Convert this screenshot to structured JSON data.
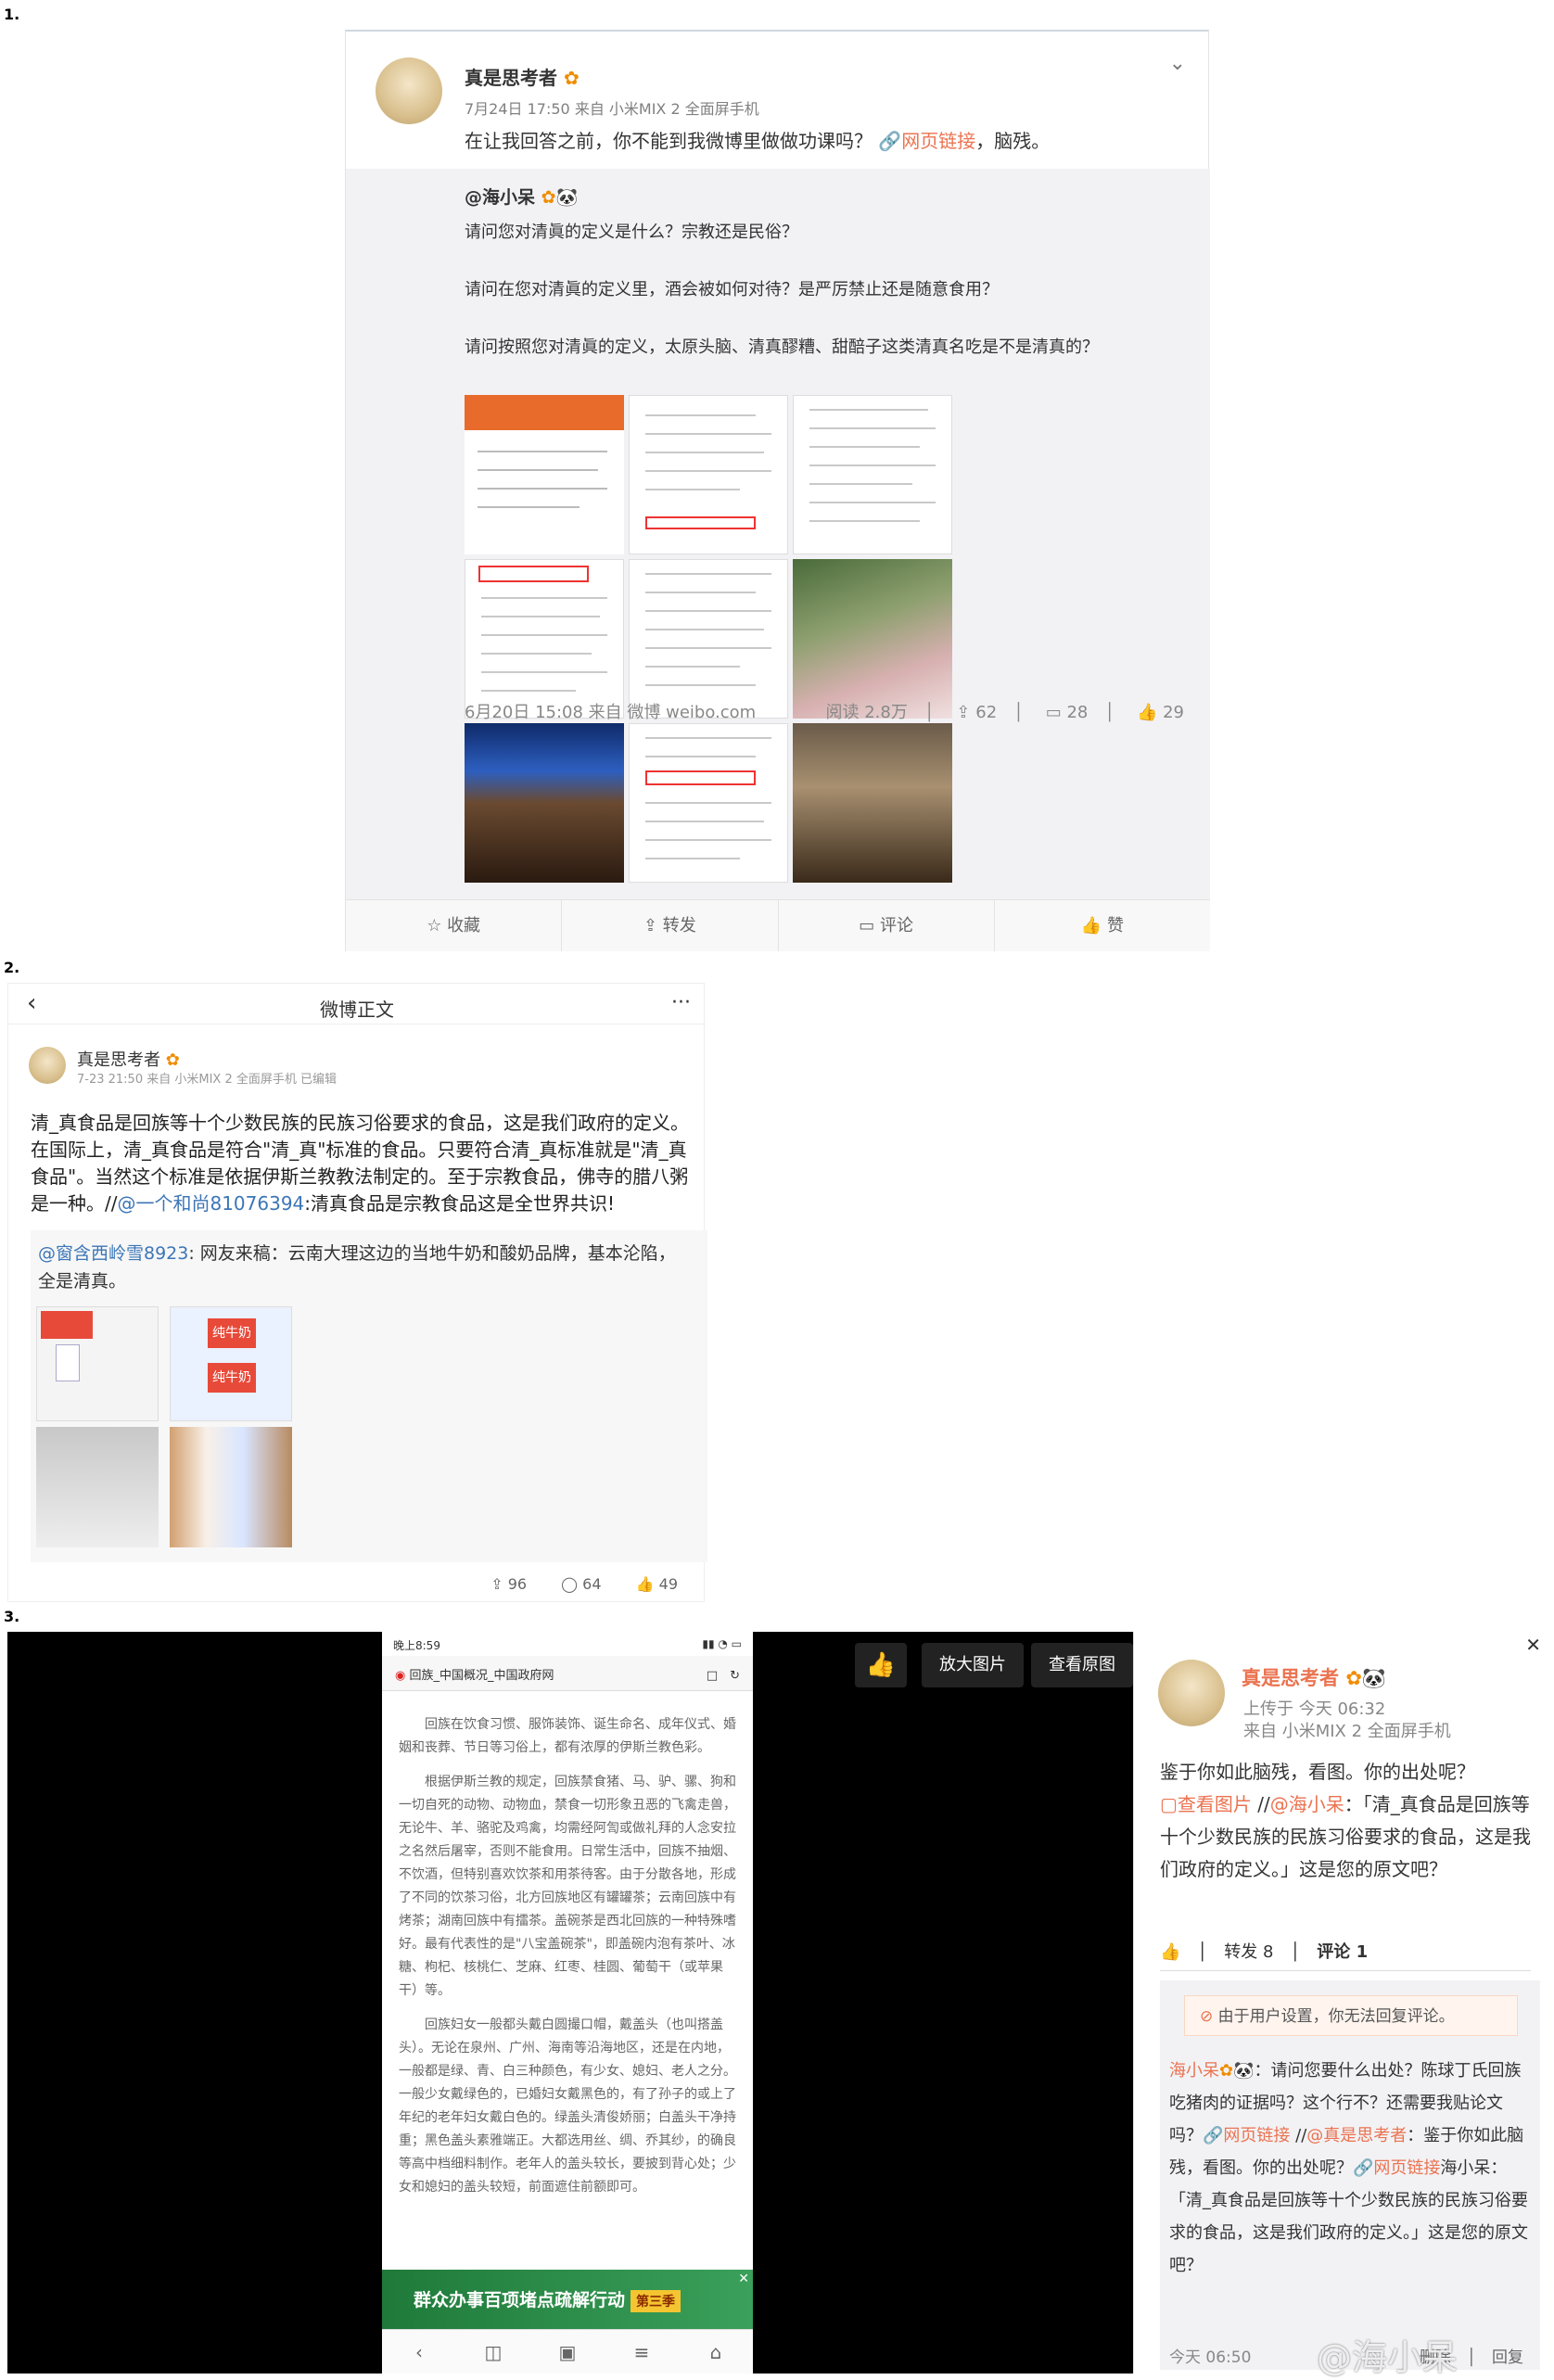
{
  "labels": {
    "n1": "1.",
    "n2": "2.",
    "n3": "3."
  },
  "p1": {
    "username": "真是思考者",
    "meta": "7月24日 17:50 来自 小米MIX 2 全面屏手机",
    "text_a": "在让我回答之前，你不能到我微博里做做功课吗？",
    "link": "网页链接",
    "text_b": "，脑残。",
    "repost_user": "@海小呆",
    "q1": "请问您对清眞的定义是什么？宗教还是民俗？",
    "q2": "请问在您对清眞的定义里，酒会被如何对待？是严厉禁止还是随意食用？",
    "q3": "请问按照您对清眞的定义，太原头脑、清真醪糟、甜醅子这类清真名吃是不是清真的？",
    "repost_meta": "6月20日 15:08 来自 微博 weibo.com",
    "reads": "阅读 2.8万",
    "reposts": "62",
    "comments": "28",
    "likes": "29",
    "act_fav": "收藏",
    "act_repost": "转发",
    "act_comment": "评论",
    "act_like": "赞"
  },
  "p2": {
    "nav_title": "微博正文",
    "username": "真是思考者",
    "meta": "7-23 21:50 来自 小米MIX 2 全面屏手机 已编辑",
    "body_a": "清_真食品是回族等十个少数民族的民族习俗要求的食品，这是我们政府的定义。在国际上，清_真食品是符合\"清_真\"标准的食品。只要符合清_真标准就是\"清_真食品\"。当然这个标准是依据伊斯兰教教法制定的。至于宗教食品，佛寺的腊八粥是一种。//",
    "body_mention": "@一个和尚81076394",
    "body_b": ":清真食品是宗教食品这是全世界共识!",
    "rep_mention": "@窗含西岭雪8923",
    "rep_text": ": 网友来稿：云南大理这边的当地牛奶和酸奶品牌，基本沦陷，全是清真。",
    "thumb_text": "纯牛奶",
    "reposts": "96",
    "comments": "64",
    "likes": "49"
  },
  "p3": {
    "status_time": "晚上8:59",
    "url_title": "回族_中国概况_中国政府网",
    "para1": "回族在饮食习惯、服饰装饰、诞生命名、成年仪式、婚姻和丧葬、节日等习俗上，都有浓厚的伊斯兰教色彩。",
    "para2": "根据伊斯兰教的规定，回族禁食猪、马、驴、骡、狗和一切自死的动物、动物血，禁食一切形象丑恶的飞禽走兽，无论牛、羊、骆驼及鸡禽，均需经阿訇或做礼拜的人念安拉之名然后屠宰，否则不能食用。日常生活中，回族不抽烟、不饮酒，但特别喜欢饮茶和用茶待客。由于分散各地，形成了不同的饮茶习俗，北方回族地区有罐罐茶；云南回族中有烤茶；湖南回族中有擂茶。盖碗茶是西北回族的一种特殊嗜好。最有代表性的是\"八宝盖碗茶\"，即盖碗内泡有茶叶、冰糖、枸杞、核桃仁、芝麻、红枣、桂圆、葡萄干（或苹果干）等。",
    "para3": "回族妇女一般都头戴白圆撮口帽，戴盖头（也叫搭盖头）。无论在泉州、广州、海南等沿海地区，还是在内地，一般都是绿、青、白三种颜色，有少女、媳妇、老人之分。一般少女戴绿色的，已婚妇女戴黑色的，有了孙子的或上了年纪的老年妇女戴白色的。绿盖头清俊娇丽；白盖头干净持重；黑色盖头素雅端正。大都选用丝、绸、乔其纱，的确良等高中档细料制作。老年人的盖头较长，要披到背心处；少女和媳妇的盖头较短，前面遮住前额即可。",
    "banner": "群众办事百项堵点疏解行动",
    "banner_tag": "第三季",
    "btn_zoom": "放大图片",
    "btn_orig": "查看原图",
    "username": "真是思考者",
    "upload": "上传于 今天 06:32",
    "source": "来自 小米MIX 2 全面屏手机",
    "text_a": "鉴于你如此脑残，看图。你的出处呢？",
    "view_img": "查看图片",
    "text_mention": "@海小呆",
    "text_b": "：「清_真食品是回族等十个少数民族的民族习俗要求的食品，这是我们政府的定义。」这是您的原文吧？",
    "reposts": "转发 8",
    "comments": "评论 1",
    "notice": "由于用户设置，你无法回复评论。",
    "c_user": "海小呆",
    "c_a": "：请问您要什么出处？陈球丁氏回族吃猪肉的证据吗？这个行不？还需要我贴论文吗？",
    "c_link1": "网页链接",
    "c_mention": "@真是思考者",
    "c_b": "：鉴于你如此脑残，看图。你的出处呢？",
    "c_link2": "网页链接",
    "c_c": "海小呆：「清_真食品是回族等十个少数民族的民族习俗要求的食品，这是我们政府的定义。」这是您的原文吧？",
    "c_time": "今天 06:50",
    "c_delete": "删除",
    "c_reply": "回复",
    "watermark": "@海小呆"
  }
}
